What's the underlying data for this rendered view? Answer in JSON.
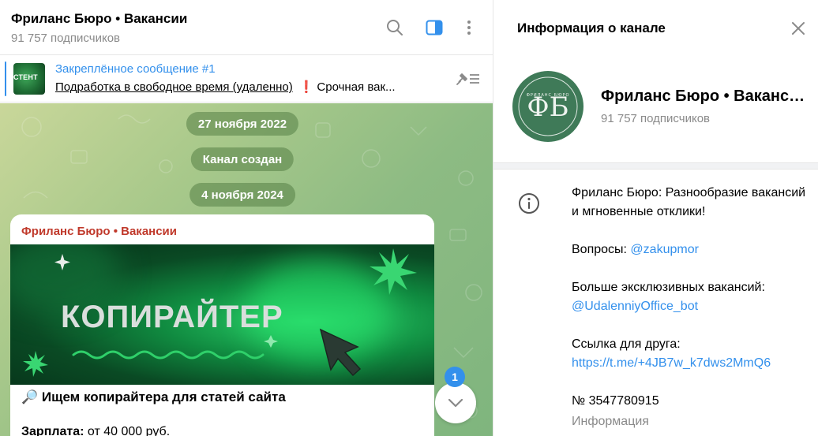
{
  "chat": {
    "title": "Фриланс Бюро • Вакансии",
    "subtitle": "91 757 подписчиков",
    "header_icons": [
      "search-icon",
      "sidebar-toggle-icon",
      "more-vertical-icon"
    ],
    "pinned": {
      "title": "Закреплённое сообщение #1",
      "thumb_text": "СТЕНТ",
      "text_main": "Подработка в свободное время (удаленно)",
      "text_mark": "❗",
      "text_rest": "Срочная вак..."
    },
    "service_pills": [
      "27 ноября 2022",
      "Канал создан",
      "4 ноября 2024"
    ],
    "message": {
      "author": "Фриланс Бюро • Вакансии",
      "image_title": "КОПИРАЙТЕР",
      "line1": "🔎 Ищем копирайтера для статей сайта",
      "line2_label": "Зарплата:",
      "line2_value": " от 40 000 руб."
    },
    "unread_count": "1"
  },
  "info": {
    "header_title": "Информация о канале",
    "name": "Фриланс Бюро • Вакансии",
    "subscribers": "91 757 подписчиков",
    "avatar_text": "ФБ",
    "avatar_arc_text": "ФРИЛАНС БЮРО",
    "description": "Фриланс Бюро: Разнообразие вакансий и мгновенные отклики!",
    "questions_label": "Вопросы: ",
    "questions_link": "@zakupmor",
    "exclusive_label": "Больше эксклюзивных вакансий:",
    "exclusive_link": "@UdalenniyOffice_bot",
    "friend_label": "Ссылка для друга:",
    "friend_link": "https://t.me/+4JB7w_k7dws2MmQ6",
    "number": "№ 3547780915",
    "info_label": "Информация"
  },
  "colors": {
    "accent": "#3390ec",
    "author": "#c0392b",
    "badge": "#3390ec"
  }
}
